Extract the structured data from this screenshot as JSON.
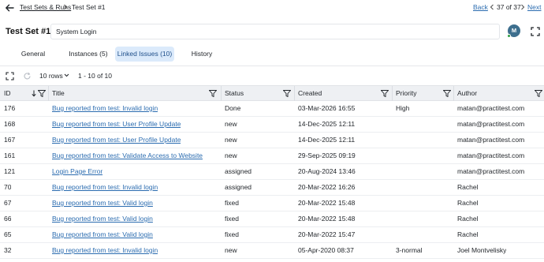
{
  "breadcrumb": {
    "parent_label": "Test Sets & Runs",
    "current_label": "Test Set #1"
  },
  "navigation": {
    "back_label": "Back",
    "position_label": "37 of 37",
    "next_label": "Next"
  },
  "header": {
    "title": "Test Set #1",
    "name_value": "System Login",
    "avatar_initial": "M"
  },
  "tabs": [
    {
      "label": "General",
      "active": false
    },
    {
      "label": "Instances (5)",
      "active": false
    },
    {
      "label": "Linked Issues (10)",
      "active": true
    },
    {
      "label": "History",
      "active": false
    }
  ],
  "toolbar": {
    "rows_per_page": "10 rows",
    "range_label": "1 - 10 of 10"
  },
  "table": {
    "columns": [
      "ID",
      "Title",
      "Status",
      "Created",
      "Priority",
      "Author"
    ],
    "rows": [
      {
        "id": "176",
        "title": "Bug reported from test: Invalid login",
        "status": "Done",
        "created": "03-Mar-2026 16:55",
        "priority": "High",
        "author": "matan@practitest.com"
      },
      {
        "id": "168",
        "title": "Bug reported from test: User Profile Update",
        "status": "new",
        "created": "14-Dec-2025 12:11",
        "priority": "",
        "author": "matan@practitest.com"
      },
      {
        "id": "167",
        "title": "Bug reported from test: User Profile Update",
        "status": "new",
        "created": "14-Dec-2025 12:11",
        "priority": "",
        "author": "matan@practitest.com"
      },
      {
        "id": "161",
        "title": "Bug reported from test: Validate Access to Website",
        "status": "new",
        "created": "29-Sep-2025 09:19",
        "priority": "",
        "author": "matan@practitest.com"
      },
      {
        "id": "121",
        "title": "Login Page Error",
        "status": "assigned",
        "created": "20-Aug-2024 13:46",
        "priority": "",
        "author": "matan@practitest.com"
      },
      {
        "id": "70",
        "title": "Bug reported from test: Invalid login",
        "status": "assigned",
        "created": "20-Mar-2022 16:26",
        "priority": "",
        "author": "Rachel"
      },
      {
        "id": "67",
        "title": "Bug reported from test: Valid login",
        "status": "fixed",
        "created": "20-Mar-2022 15:48",
        "priority": "",
        "author": "Rachel"
      },
      {
        "id": "66",
        "title": "Bug reported from test: Valid login",
        "status": "fixed",
        "created": "20-Mar-2022 15:48",
        "priority": "",
        "author": "Rachel"
      },
      {
        "id": "65",
        "title": "Bug reported from test: Valid login",
        "status": "fixed",
        "created": "20-Mar-2022 15:47",
        "priority": "",
        "author": "Rachel"
      },
      {
        "id": "32",
        "title": "Bug reported from test: Invalid login",
        "status": "new",
        "created": "05-Apr-2020 08:37",
        "priority": "3-normal",
        "author": "Joel Montvelisky"
      }
    ]
  },
  "colors": {
    "link": "#2b6cb0",
    "active_tab_bg": "#dbeafb",
    "header_bg": "#eef0f3",
    "avatar_bg": "#3e6f8e",
    "presence": "#2f9e44"
  },
  "icons": [
    "back-arrow-icon",
    "chevron-right-icon",
    "chevron-left-icon",
    "expand-icon",
    "refresh-icon",
    "chevron-down-icon",
    "sort-down-icon",
    "filter-icon"
  ]
}
